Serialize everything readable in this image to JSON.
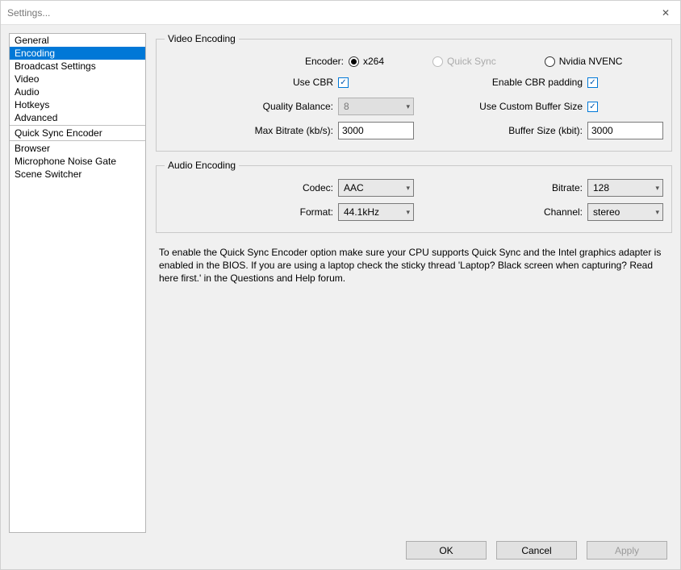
{
  "window": {
    "title": "Settings..."
  },
  "sidebar": {
    "group1": [
      "General",
      "Encoding",
      "Broadcast Settings",
      "Video",
      "Audio",
      "Hotkeys",
      "Advanced"
    ],
    "group2": [
      "Quick Sync Encoder"
    ],
    "group3": [
      "Browser",
      "Microphone Noise Gate",
      "Scene Switcher"
    ],
    "selected": "Encoding"
  },
  "video_encoding": {
    "legend": "Video Encoding",
    "encoder_label": "Encoder:",
    "encoder_options": {
      "x264": "x264",
      "quick_sync": "Quick Sync",
      "nvenc": "Nvidia NVENC"
    },
    "encoder_selected": "x264",
    "use_cbr_label": "Use CBR",
    "use_cbr_checked": true,
    "enable_cbr_padding_label": "Enable CBR padding",
    "enable_cbr_padding_checked": true,
    "quality_balance_label": "Quality Balance:",
    "quality_balance_value": "8",
    "use_custom_buffer_label": "Use Custom Buffer Size",
    "use_custom_buffer_checked": true,
    "max_bitrate_label": "Max Bitrate (kb/s):",
    "max_bitrate_value": "3000",
    "buffer_size_label": "Buffer Size (kbit):",
    "buffer_size_value": "3000"
  },
  "audio_encoding": {
    "legend": "Audio Encoding",
    "codec_label": "Codec:",
    "codec_value": "AAC",
    "bitrate_label": "Bitrate:",
    "bitrate_value": "128",
    "format_label": "Format:",
    "format_value": "44.1kHz",
    "channel_label": "Channel:",
    "channel_value": "stereo"
  },
  "help_text": "To enable the Quick Sync Encoder option make sure your CPU supports Quick Sync and the Intel graphics adapter is enabled in the BIOS. If you are using a laptop check the sticky thread 'Laptop? Black screen when capturing? Read here first.' in the Questions and Help forum.",
  "footer": {
    "ok": "OK",
    "cancel": "Cancel",
    "apply": "Apply"
  }
}
